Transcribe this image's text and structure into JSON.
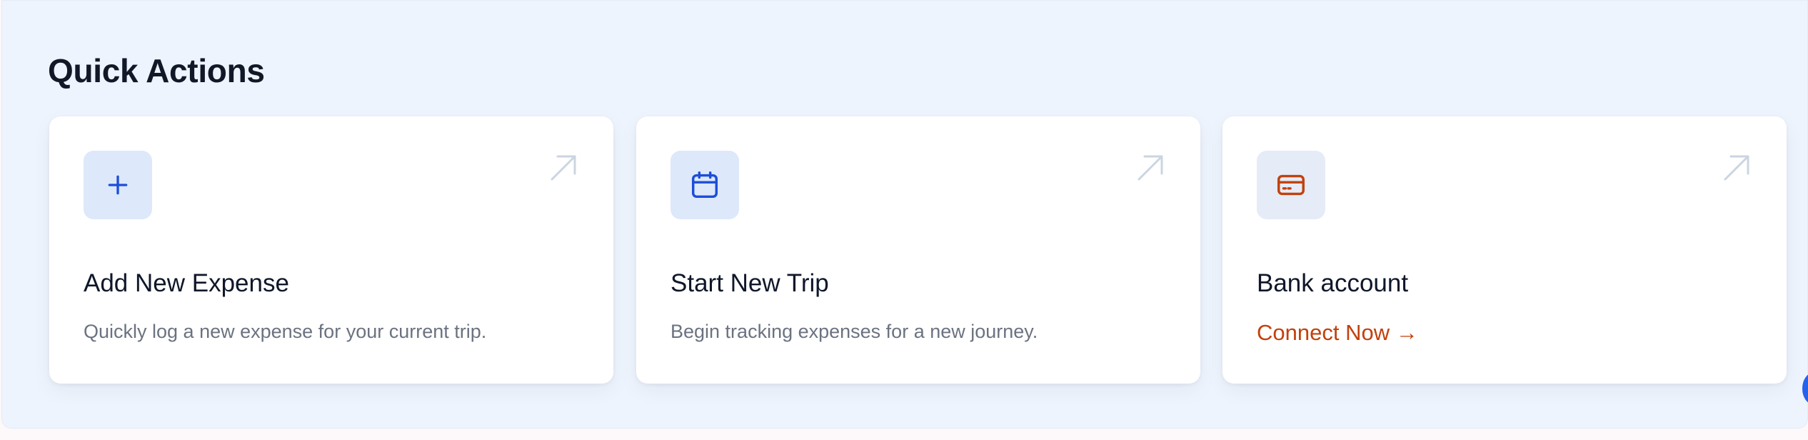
{
  "section": {
    "title": "Quick Actions"
  },
  "cards": [
    {
      "icon": "plus-icon",
      "title": "Add New Expense",
      "description": "Quickly log a new expense for your current trip."
    },
    {
      "icon": "calendar-icon",
      "title": "Start New Trip",
      "description": "Begin tracking expenses for a new journey."
    },
    {
      "icon": "credit-card-icon",
      "title": "Bank account",
      "link": "Connect Now →"
    }
  ],
  "colors": {
    "panel_bg": "#eef4fd",
    "icon_blue": "#1d4ed8",
    "icon_orange": "#c2410c",
    "link": "#c2410c",
    "title": "#111827",
    "muted": "#6b7280"
  }
}
